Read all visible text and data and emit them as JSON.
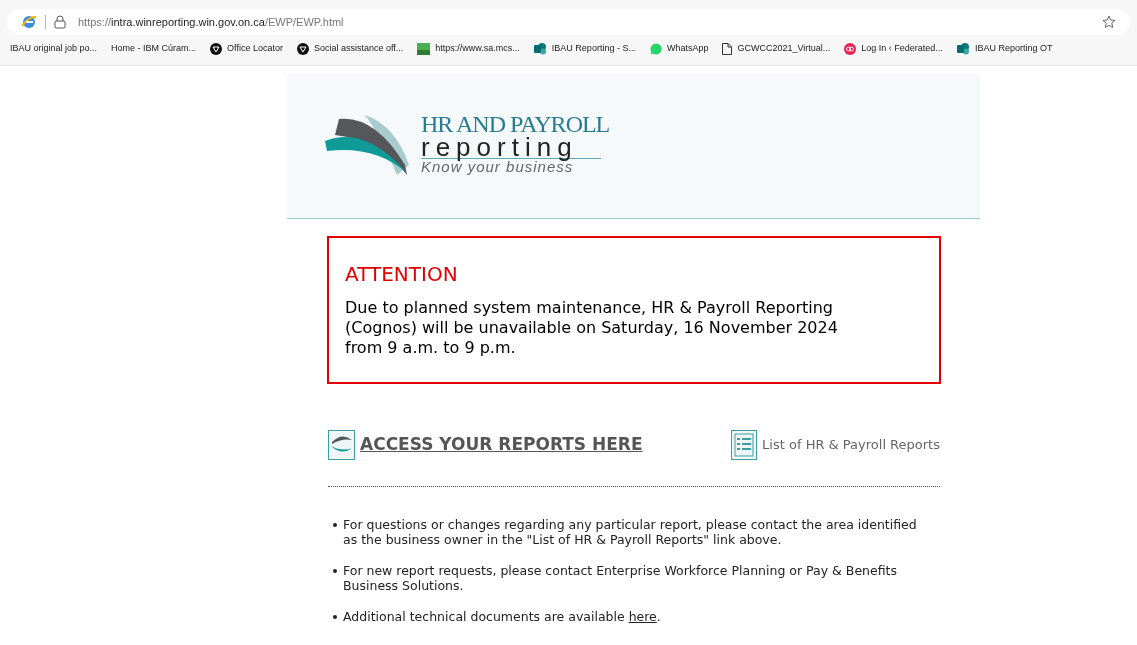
{
  "browser": {
    "address": {
      "scheme": "https://",
      "host": "intra.winreporting.win.gov.on.ca",
      "path": "/EWP/EWP.html"
    },
    "bookmarks": [
      {
        "label": "IBAU original job po...",
        "kind": "none"
      },
      {
        "label": "Home - IBM Cúram...",
        "kind": "none"
      },
      {
        "label": "Office Locator",
        "kind": "shield"
      },
      {
        "label": "Social assistance off...",
        "kind": "shield"
      },
      {
        "label": "https://www.sa.mcs...",
        "kind": "sa"
      },
      {
        "label": "IBAU Reporting - S...",
        "kind": "sharepoint"
      },
      {
        "label": "WhatsApp",
        "kind": "chat"
      },
      {
        "label": "GCWCC2021_Virtual...",
        "kind": "document"
      },
      {
        "label": "Log In ‹ Federated...",
        "kind": "federated"
      },
      {
        "label": "IBAU Reporting OT",
        "kind": "sharepoint"
      }
    ]
  },
  "logo": {
    "title": "HR AND PAYROLL",
    "word": "reporting",
    "tagline": "Know your business"
  },
  "notice": {
    "title": "ATTENTION",
    "message": "Due to planned system maintenance, HR & Payroll Reporting (Cognos) will be unavailable on Saturday, 16 November 2024 from 9 a.m. to 9 p.m."
  },
  "links": {
    "access": "ACCESS YOUR REPORTS HERE",
    "list": "List of HR & Payroll Reports"
  },
  "bullets": [
    {
      "text": "For questions or changes regarding any particular report, please contact the area identified as the business owner in the \"List of HR & Payroll Reports\" link above."
    },
    {
      "text": "For new report requests, please contact Enterprise Workforce Planning or Pay & Benefits Business Solutions."
    },
    {
      "text": "Additional technical documents are available ",
      "link": "here",
      "after": "."
    }
  ]
}
